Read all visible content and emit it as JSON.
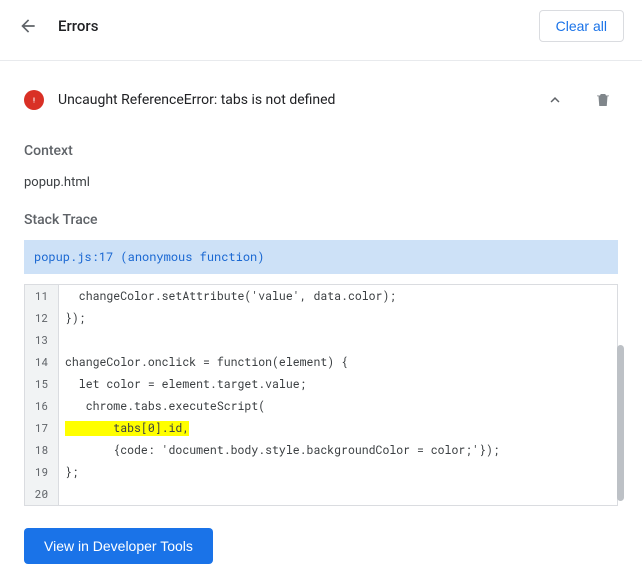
{
  "header": {
    "title": "Errors",
    "clear_all": "Clear all"
  },
  "error": {
    "message": "Uncaught ReferenceError: tabs is not defined",
    "context_label": "Context",
    "context_value": "popup.html",
    "stack_label": "Stack Trace",
    "trace_header": "popup.js:17 (anonymous function)"
  },
  "code": {
    "highlight_line": 17,
    "lines": [
      {
        "n": 11,
        "t": "  changeColor.setAttribute('value', data.color);"
      },
      {
        "n": 12,
        "t": "});"
      },
      {
        "n": 13,
        "t": ""
      },
      {
        "n": 14,
        "t": "changeColor.onclick = function(element) {"
      },
      {
        "n": 15,
        "t": "  let color = element.target.value;"
      },
      {
        "n": 16,
        "t": "   chrome.tabs.executeScript("
      },
      {
        "n": 17,
        "t": "       tabs[0].id,"
      },
      {
        "n": 18,
        "t": "       {code: 'document.body.style.backgroundColor = color;'});"
      },
      {
        "n": 19,
        "t": "};"
      },
      {
        "n": 20,
        "t": ""
      }
    ]
  },
  "footer": {
    "dev_tools_btn": "View in Developer Tools"
  }
}
